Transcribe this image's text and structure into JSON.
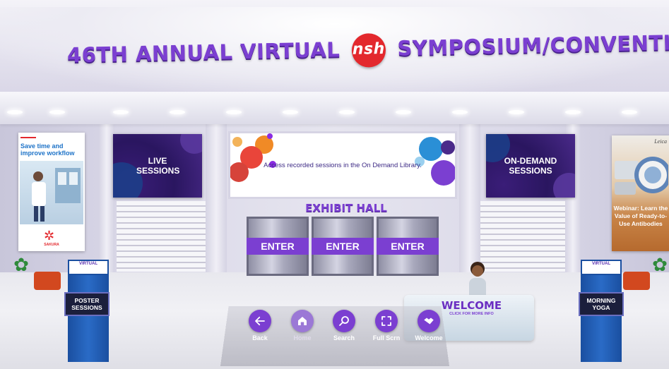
{
  "title": {
    "part1": "46TH ANNUAL VIRTUAL",
    "logo": "nsh",
    "part2": "SYMPOSIUM/CONVENTION"
  },
  "screens": {
    "live": "LIVE SESSIONS",
    "center": "Access recorded sessions in the On Demand Library.",
    "on_demand": "ON-DEMAND SESSIONS"
  },
  "exhibit_hall": {
    "title": "EXHIBIT HALL",
    "doors": [
      "ENTER",
      "ENTER",
      "ENTER"
    ]
  },
  "banners": {
    "left": {
      "text": "Save time and improve workflow",
      "brand": "SAKURA"
    },
    "right": {
      "brand": "Leica",
      "text": "Webinar: Learn the Value of Ready-to-Use Antibodies"
    }
  },
  "kiosks": {
    "left_label": "POSTER SESSIONS",
    "right_label": "MORNING YOGA",
    "top_text": "VIRTUAL"
  },
  "welcome": {
    "title": "WELCOME",
    "subtitle": "CLICK FOR MORE INFO"
  },
  "nav": [
    {
      "label": "Back",
      "icon": "arrow-left-icon"
    },
    {
      "label": "Home",
      "icon": "home-icon"
    },
    {
      "label": "Search",
      "icon": "search-icon"
    },
    {
      "label": "Full Scrn",
      "icon": "fullscreen-icon"
    },
    {
      "label": "Welcome",
      "icon": "handshake-icon"
    }
  ],
  "colors": {
    "accent": "#7b3fd1",
    "brand_red": "#e3282d",
    "kiosk_blue": "#1a4fa0"
  }
}
